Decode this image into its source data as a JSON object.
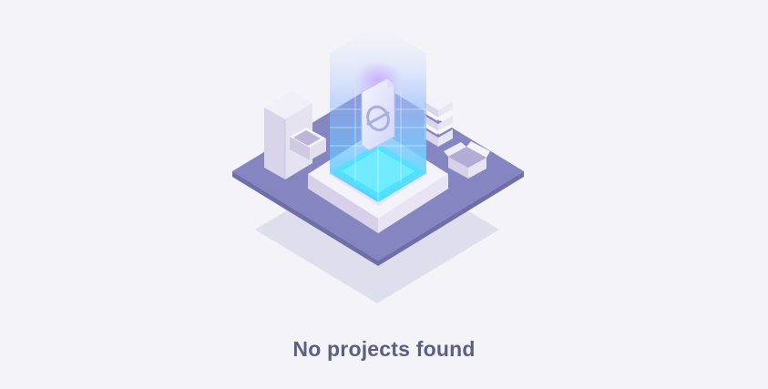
{
  "empty_state": {
    "message": "No projects found",
    "illustration_icon": "empty-document-icon",
    "colors": {
      "page_background": "#f3f3f8",
      "platform": "#8585c2",
      "shadow": "#dedeec",
      "text": "#5e5e85",
      "beam_cyan": "#5cdcff",
      "beam_violet": "#a78cff"
    }
  }
}
